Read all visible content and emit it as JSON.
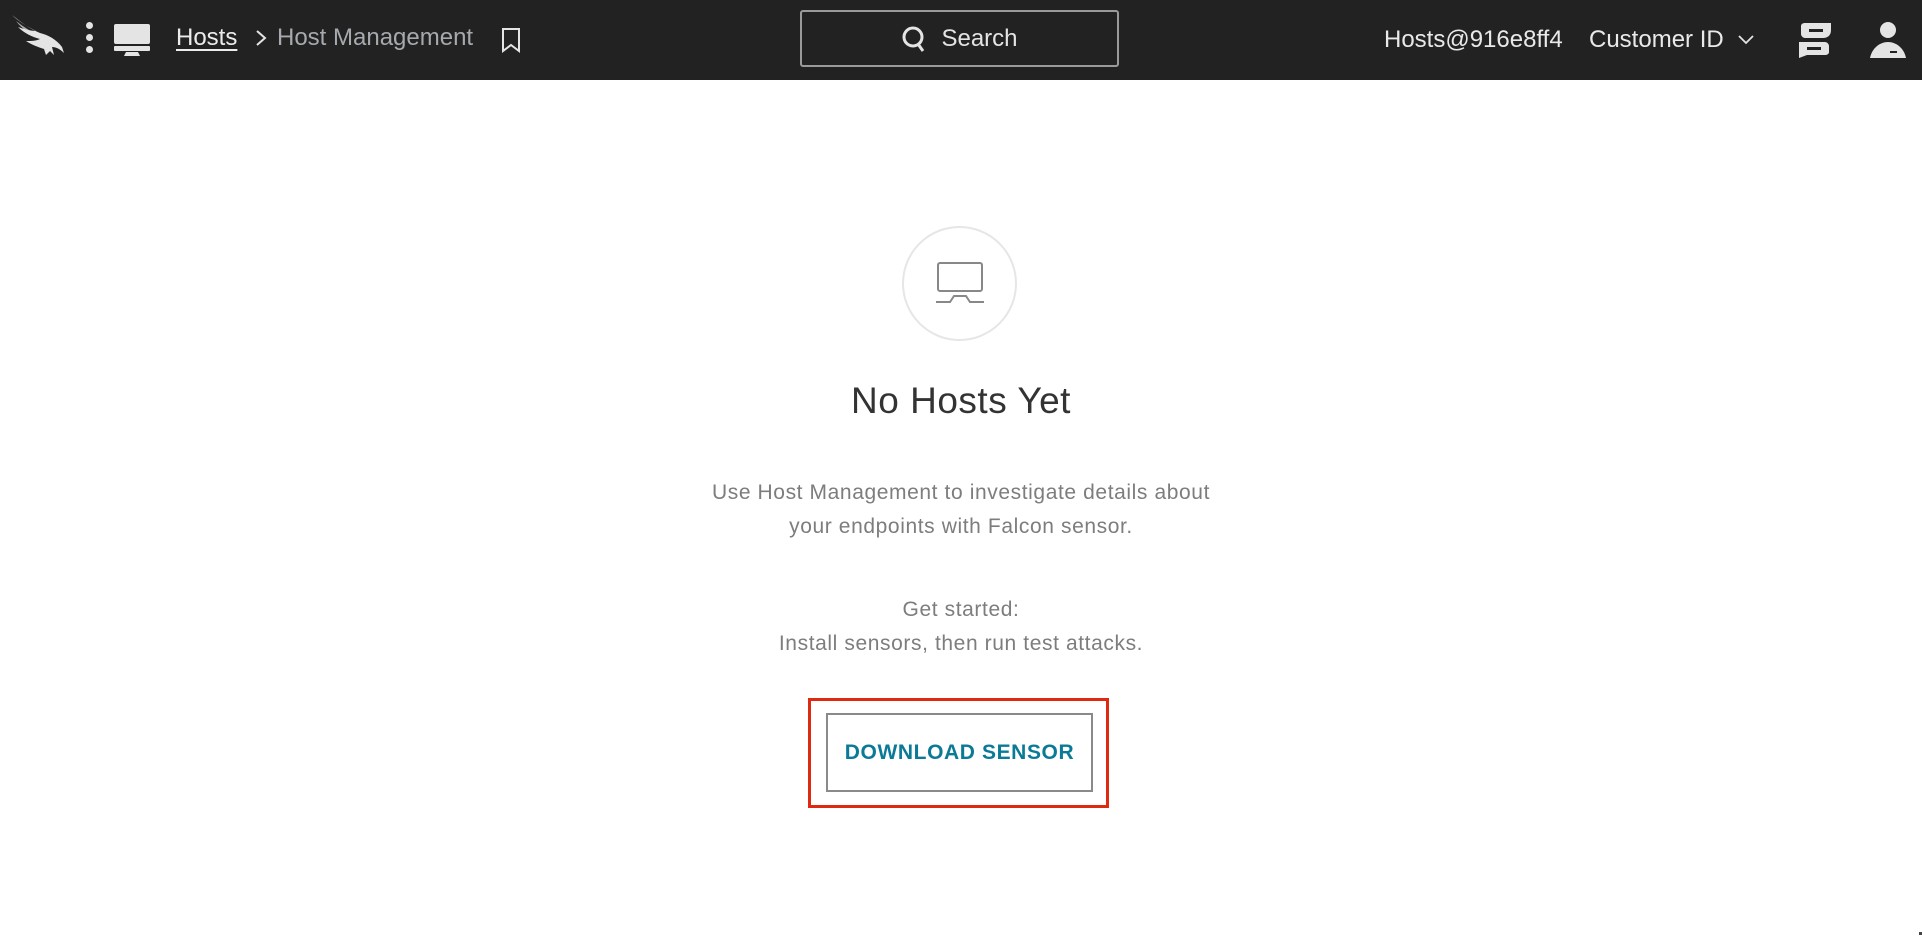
{
  "header": {
    "logo": "falcon-logo",
    "menu_icon": "kebab-menu-icon",
    "module_icon": "desktop-icon",
    "breadcrumb": {
      "root": "Hosts",
      "separator_icon": "chevron-right-icon",
      "current": "Host Management"
    },
    "bookmark_icon": "bookmark-icon",
    "search": {
      "icon": "search-icon",
      "label": "Search"
    },
    "user_label": "Hosts@916e8ff4",
    "customer_selector": {
      "label": "Customer ID",
      "icon": "chevron-down-icon"
    },
    "feed_icon": "news-feed-icon",
    "profile_icon": "user-profile-icon"
  },
  "empty_state": {
    "icon": "desktop-monitor-icon",
    "title": "No Hosts Yet",
    "description_lines": [
      "Use Host Management to investigate details about",
      "your endpoints with Falcon sensor."
    ],
    "get_started_lines": [
      "Get started:",
      "Install sensors, then run test attacks."
    ],
    "action_button": "DOWNLOAD SENSOR",
    "highlight_color": "#dd2a10",
    "button_text_color": "#0a7a96"
  }
}
